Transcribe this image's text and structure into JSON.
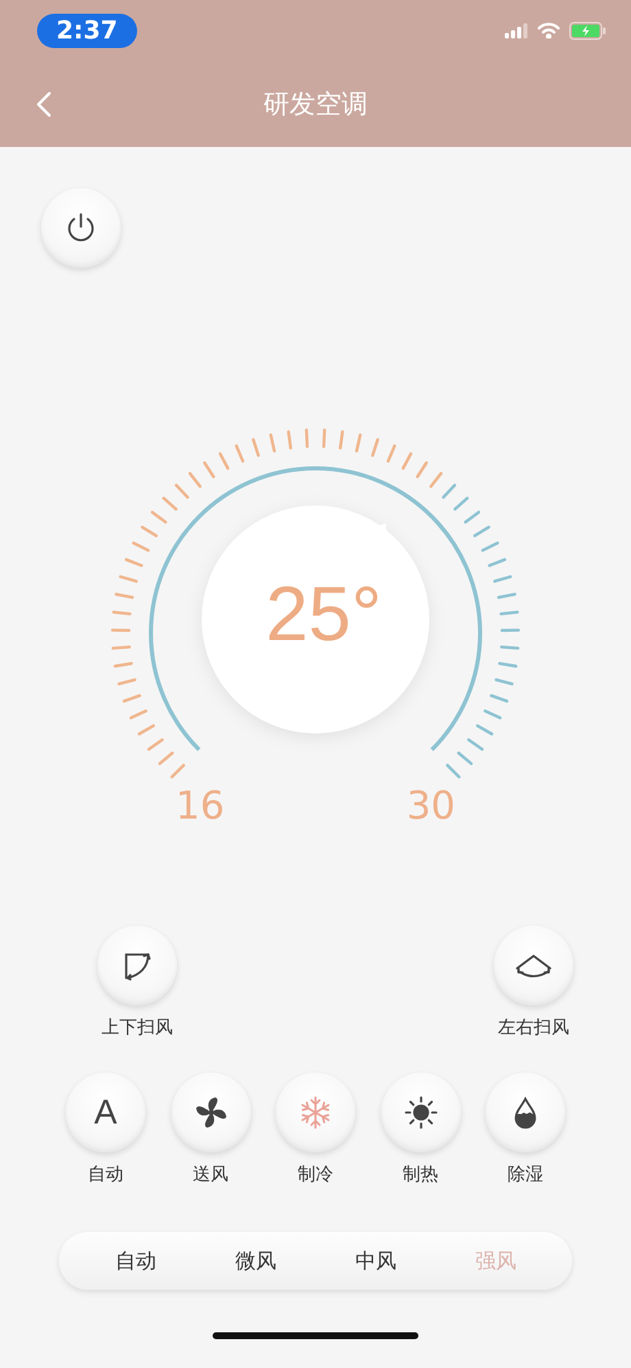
{
  "status_bar": {
    "time": "2:37"
  },
  "header": {
    "title": "研发空调"
  },
  "dial": {
    "value": "25°",
    "min": "16",
    "max": "30"
  },
  "swing": [
    {
      "kind": "vertical",
      "label": "上下扫风"
    },
    {
      "kind": "horizontal",
      "label": "左右扫风"
    }
  ],
  "modes": [
    {
      "kind": "auto",
      "symbol": "A",
      "label": "自动",
      "selected": false
    },
    {
      "kind": "fan",
      "label": "送风",
      "selected": false
    },
    {
      "kind": "cool",
      "label": "制冷",
      "selected": true
    },
    {
      "kind": "heat",
      "label": "制热",
      "selected": false
    },
    {
      "kind": "dry",
      "label": "除湿",
      "selected": false
    }
  ],
  "fan_speeds": [
    {
      "label": "自动",
      "selected": false
    },
    {
      "label": "微风",
      "selected": false
    },
    {
      "label": "中风",
      "selected": false
    },
    {
      "label": "强风",
      "selected": true
    }
  ]
}
